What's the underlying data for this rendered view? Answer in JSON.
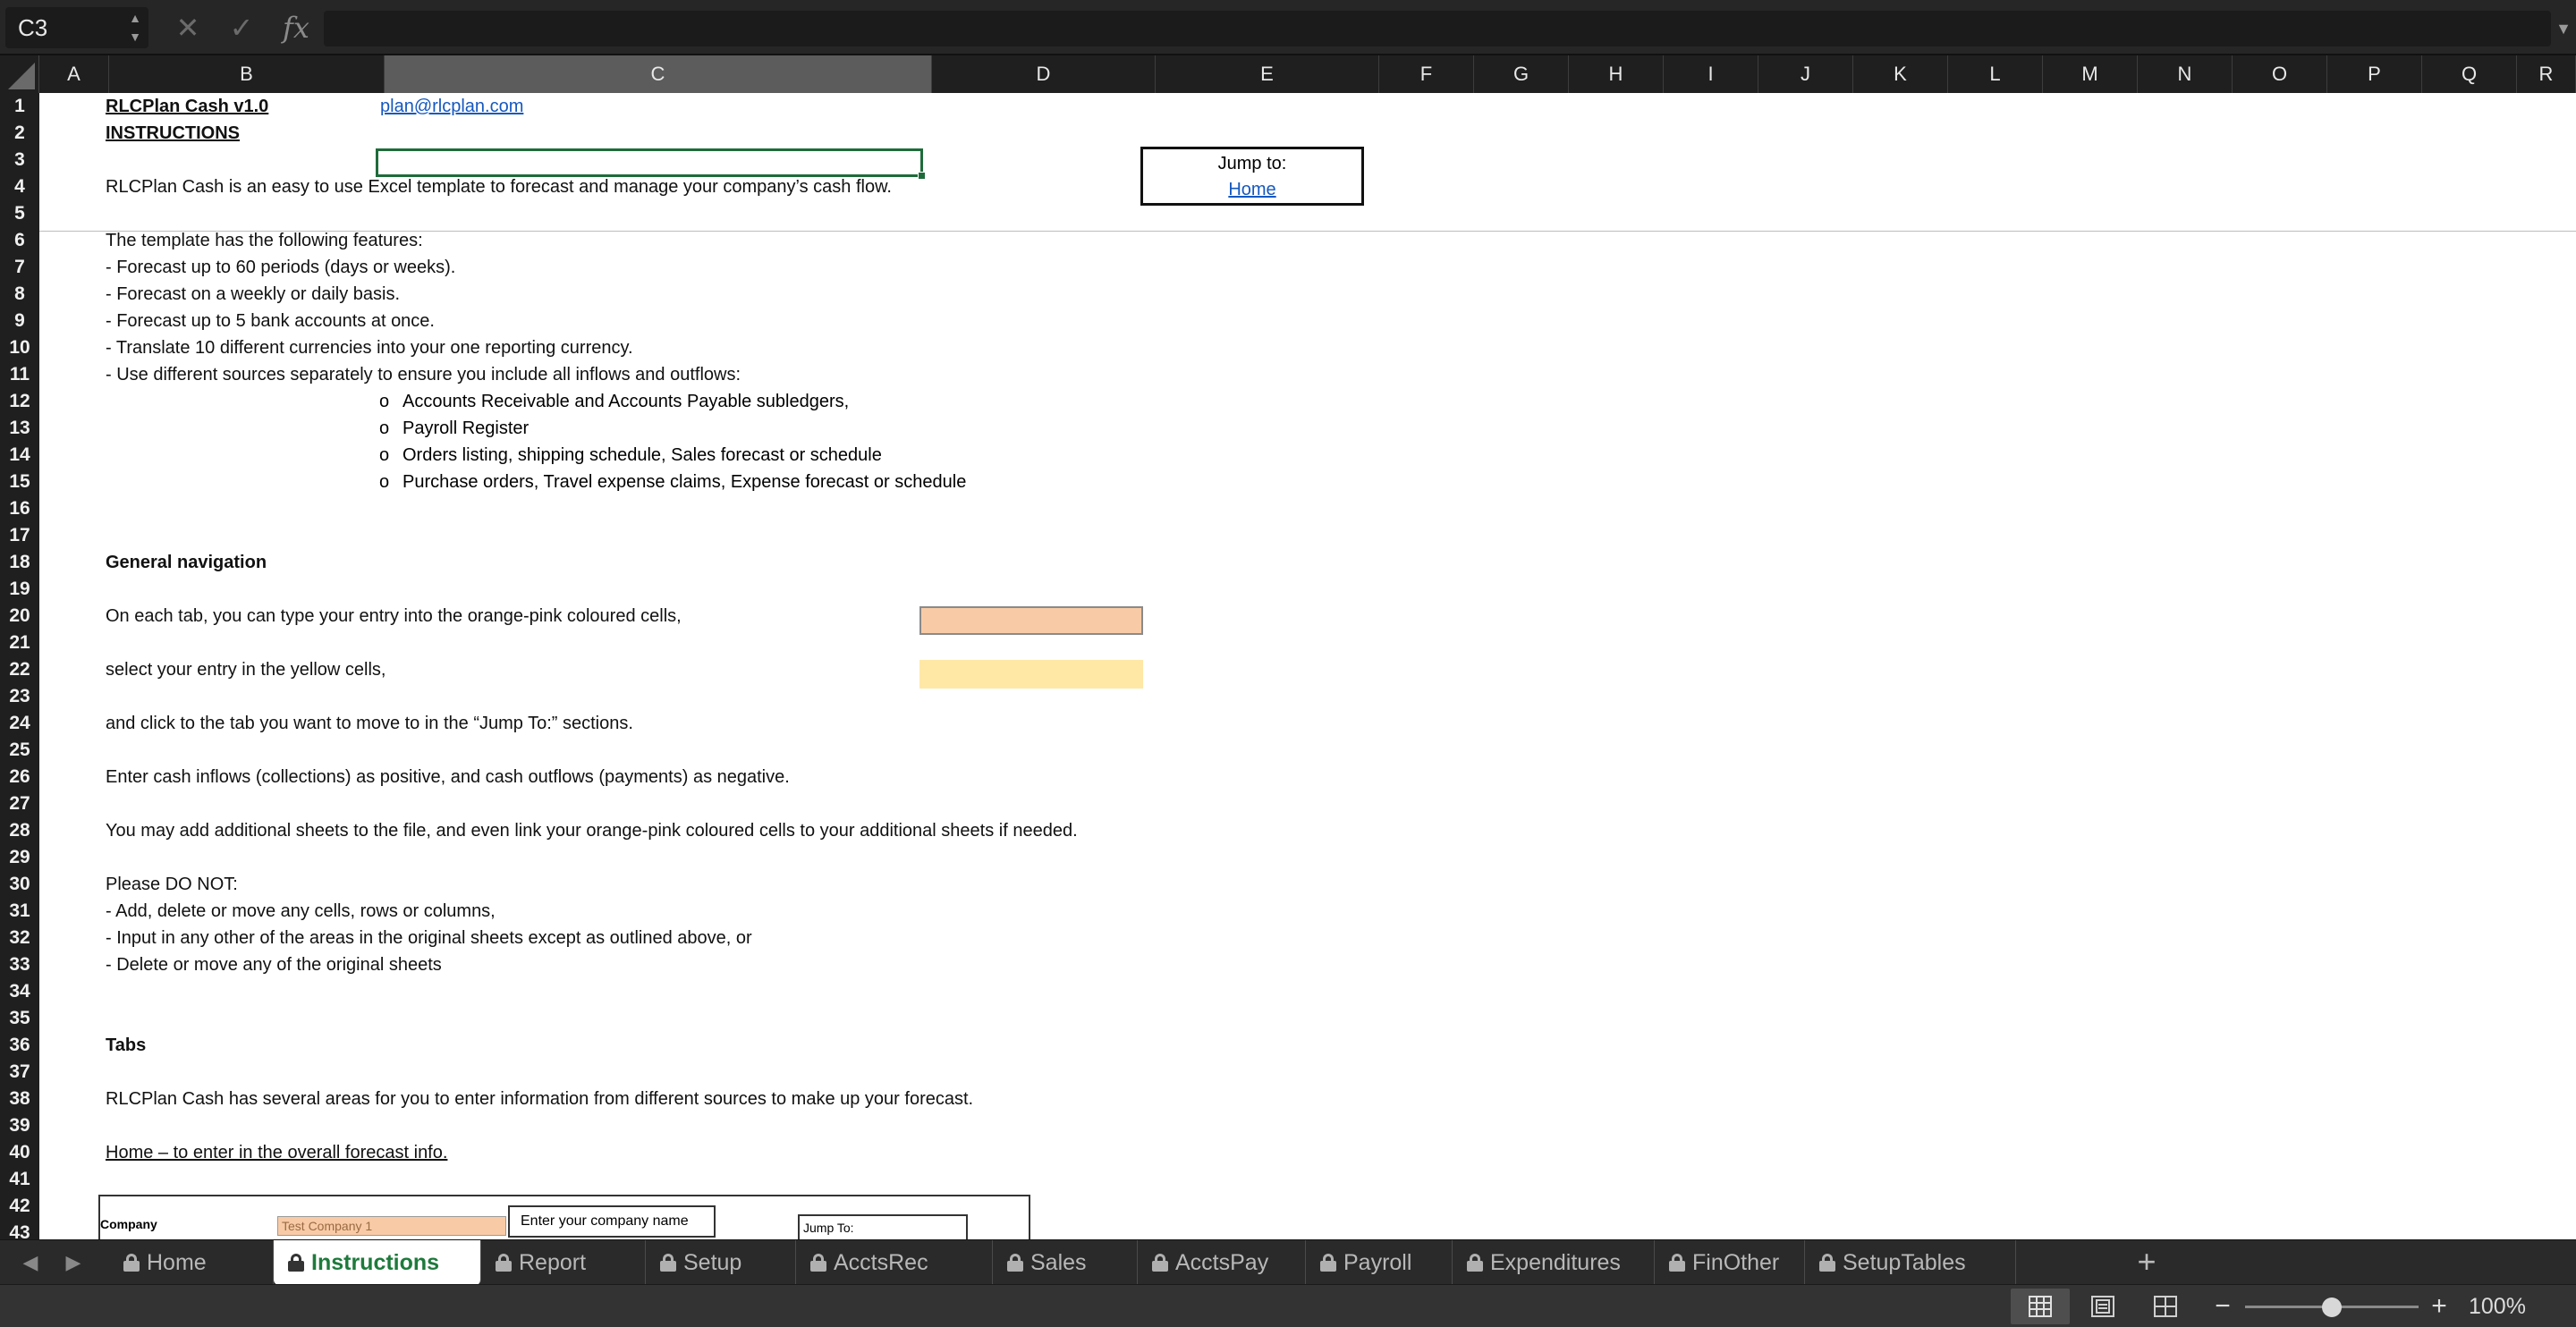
{
  "formula_bar": {
    "name_box": "C3",
    "formula_value": ""
  },
  "columns": [
    "A",
    "B",
    "C",
    "D",
    "E",
    "F",
    "G",
    "H",
    "I",
    "J",
    "K",
    "L",
    "M",
    "N",
    "O",
    "P",
    "Q",
    "R"
  ],
  "selected_column": "C",
  "rows": [
    "1",
    "2",
    "3",
    "4",
    "5",
    "6",
    "7",
    "8",
    "9",
    "10",
    "11",
    "12",
    "13",
    "14",
    "15",
    "16",
    "17",
    "18",
    "19",
    "20",
    "21",
    "22",
    "23",
    "24",
    "25",
    "26",
    "27",
    "28",
    "29",
    "30",
    "31",
    "32",
    "33",
    "34",
    "35",
    "36",
    "37",
    "38",
    "39",
    "40",
    "41",
    "42",
    "43"
  ],
  "cells": {
    "title": "RLCPlan Cash v1.0",
    "email": "plan@rlcplan.com",
    "instructions_heading": "INSTRUCTIONS",
    "intro": "RLCPlan Cash is an easy to use Excel template to forecast and manage your company’s cash flow.",
    "jump_to_label": "Jump to:",
    "jump_to_home": "Home",
    "features_heading": "The template has the following features:",
    "features": [
      "-  Forecast up to 60 periods (days or weeks).",
      "-  Forecast on a weekly or daily basis.",
      "-  Forecast up to 5 bank accounts at once.",
      "-  Translate 10 different currencies into your one reporting currency.",
      "-  Use different sources separately to ensure you include all inflows and outflows:"
    ],
    "bullet_marker": "o",
    "sources": [
      "Accounts Receivable and Accounts Payable subledgers,",
      "Payroll Register",
      "Orders listing, shipping schedule, Sales forecast or schedule",
      "Purchase orders, Travel expense claims, Expense forecast or schedule"
    ],
    "general_navigation": "General navigation",
    "nav_orange": "On each tab, you can type your entry into the orange-pink coloured cells,",
    "nav_yellow": "select your entry in the yellow cells,",
    "nav_jump": "and click to the tab you want to move to in the “Jump To:” sections.",
    "nav_cash": "Enter cash inflows (collections) as positive, and cash outflows (payments) as negative.",
    "nav_sheets": "You may add additional sheets to the file, and even link your orange-pink coloured cells to your additional sheets if needed.",
    "donot_heading": "Please DO NOT:",
    "donot": [
      "-  Add, delete or move any cells, rows or columns,",
      "-  Input in any other of the areas in the original sheets except as outlined above, or",
      "-  Delete or move any of the original sheets"
    ],
    "tabs_heading": "Tabs",
    "tabs_intro": "RLCPlan Cash has several areas for you to enter information from different sources to make up your forecast.",
    "home_desc": "Home – to enter in the overall forecast info."
  },
  "preview": {
    "company_label": "Company",
    "company_value": "Test Company 1",
    "note": "Enter your company name",
    "jump_to": "Jump To:"
  },
  "tabs": [
    {
      "label": "Home",
      "locked": true
    },
    {
      "label": "Instructions",
      "locked": true,
      "active": true
    },
    {
      "label": "Report",
      "locked": true
    },
    {
      "label": "Setup",
      "locked": true
    },
    {
      "label": "AcctsRec",
      "locked": true
    },
    {
      "label": "Sales",
      "locked": true
    },
    {
      "label": "AcctsPay",
      "locked": true
    },
    {
      "label": "Payroll",
      "locked": true
    },
    {
      "label": "Expenditures",
      "locked": true
    },
    {
      "label": "FinOther",
      "locked": true
    },
    {
      "label": "SetupTables",
      "locked": true
    }
  ],
  "status": {
    "zoom": "100%",
    "zoom_fraction": 0.5,
    "active_view": "normal"
  },
  "colors": {
    "accent_green": "#1e7a3c",
    "input_orange": "#f8cba6",
    "select_yellow": "#ffe7a6",
    "link_blue": "#1558c0"
  }
}
